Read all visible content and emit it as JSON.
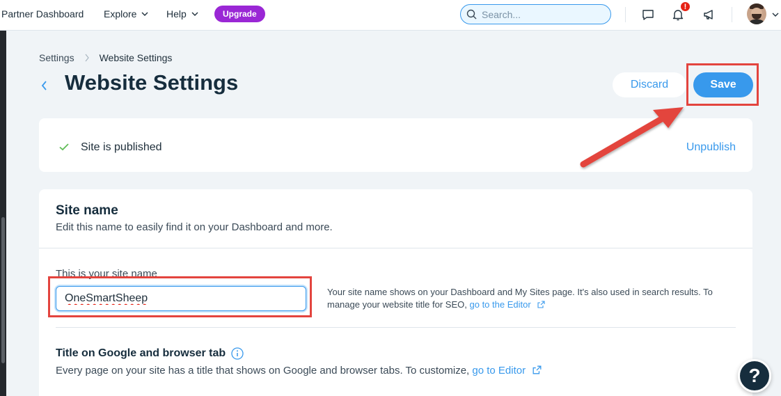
{
  "topbar": {
    "brand": "Partner Dashboard",
    "explore_label": "Explore",
    "help_label": "Help",
    "upgrade_label": "Upgrade",
    "search_placeholder": "Search...",
    "notification_count": "!"
  },
  "breadcrumb": {
    "parent": "Settings",
    "current": "Website Settings"
  },
  "header": {
    "title": "Website Settings",
    "discard_label": "Discard",
    "save_label": "Save"
  },
  "publish": {
    "status": "Site is published",
    "unpublish_label": "Unpublish"
  },
  "site_name": {
    "title": "Site name",
    "description": "Edit this name to easily find it on your Dashboard and more.",
    "field_label": "This is your site name",
    "value": "OneSmartSheep",
    "help_text": "Your site name shows on your Dashboard and My Sites page. It's also used in search results. To manage your website title for SEO,",
    "help_link": "go to the Editor"
  },
  "google_title": {
    "title": "Title on Google and browser tab",
    "description": "Every page on your site has a title that shows on Google and browser tabs. To customize,",
    "link": "go to Editor"
  },
  "help_fab": {
    "label": "?"
  },
  "colors": {
    "accent": "#3899ec",
    "upgrade": "#9a27d5",
    "highlight": "#e3443e",
    "success": "#60bc57"
  }
}
